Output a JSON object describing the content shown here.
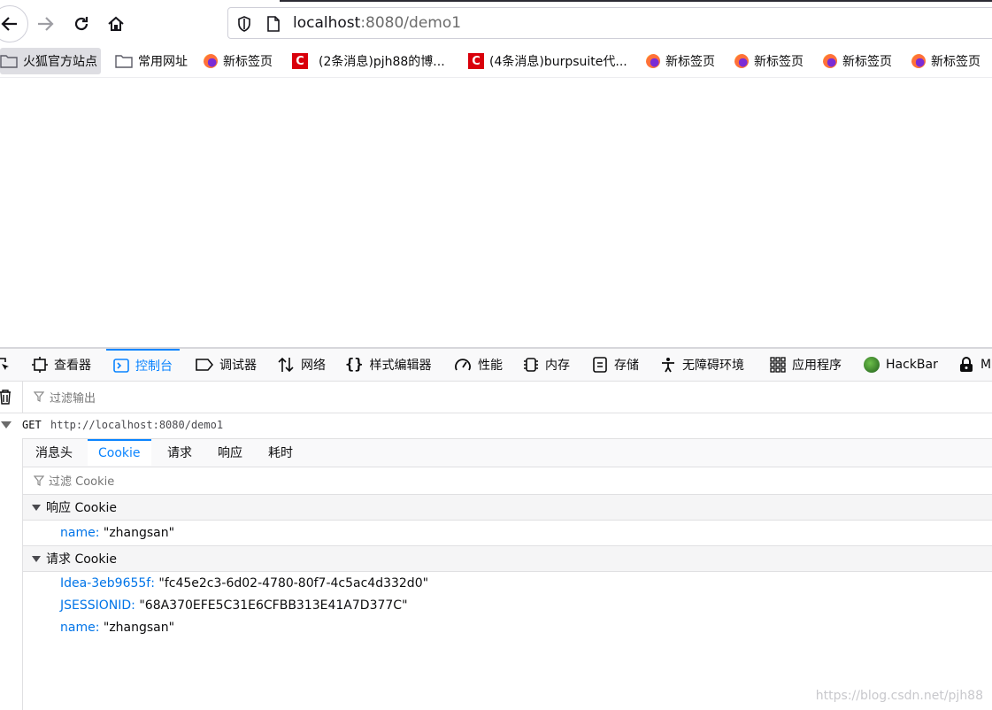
{
  "browser": {
    "url_host": "localhost",
    "url_rest": ":8080/demo1"
  },
  "bookmarks": [
    {
      "label": "火狐官方站点",
      "icon": "folder-icon"
    },
    {
      "label": "常用网址",
      "icon": "folder-icon"
    },
    {
      "label": "新标签页",
      "icon": "firefox-icon"
    },
    {
      "label": "(2条消息)pjh88的博...",
      "icon": "csdn-icon"
    },
    {
      "label": "(4条消息)burpsuite代...",
      "icon": "csdn-icon"
    },
    {
      "label": "新标签页",
      "icon": "firefox-icon"
    },
    {
      "label": "新标签页",
      "icon": "firefox-icon"
    },
    {
      "label": "新标签页",
      "icon": "firefox-icon"
    },
    {
      "label": "新标签页",
      "icon": "firefox-icon"
    }
  ],
  "devtools": {
    "tabs": [
      {
        "label": "查看器",
        "icon": "inspector-icon"
      },
      {
        "label": "控制台",
        "icon": "console-icon"
      },
      {
        "label": "调试器",
        "icon": "debugger-icon"
      },
      {
        "label": "网络",
        "icon": "network-icon"
      },
      {
        "label": "样式编辑器",
        "icon": "style-editor-icon"
      },
      {
        "label": "性能",
        "icon": "performance-icon"
      },
      {
        "label": "内存",
        "icon": "memory-icon"
      },
      {
        "label": "存储",
        "icon": "storage-icon"
      },
      {
        "label": "无障碍环境",
        "icon": "accessibility-icon"
      },
      {
        "label": "应用程序",
        "icon": "application-icon"
      },
      {
        "label": "HackBar",
        "icon": "hackbar-icon"
      },
      {
        "label": "M",
        "icon": "extension-icon"
      }
    ],
    "selected_tab": "控制台",
    "filter_placeholder": "过滤输出",
    "request": {
      "method": "GET",
      "url": "http://localhost:8080/demo1"
    },
    "detail_tabs": [
      "消息头",
      "Cookie",
      "请求",
      "响应",
      "耗时"
    ],
    "selected_detail_tab": "Cookie",
    "cookie_filter_placeholder": "过滤 Cookie",
    "response_cookies": {
      "title": "响应 Cookie",
      "items": [
        {
          "key": "name",
          "value": "\"zhangsan\""
        }
      ]
    },
    "request_cookies": {
      "title": "请求 Cookie",
      "items": [
        {
          "key": "Idea-3eb9655f",
          "value": "\"fc45e2c3-6d02-4780-80f7-4c5ac4d332d0\""
        },
        {
          "key": "JSESSIONID",
          "value": "\"68A370EFE5C31E6CFBB313E41A7D377C\""
        },
        {
          "key": "name",
          "value": "\"zhangsan\""
        }
      ]
    }
  },
  "watermark": "https://blog.csdn.net/pjh88",
  "colors": {
    "accent": "#0a84ff",
    "key": "#0074e8"
  }
}
